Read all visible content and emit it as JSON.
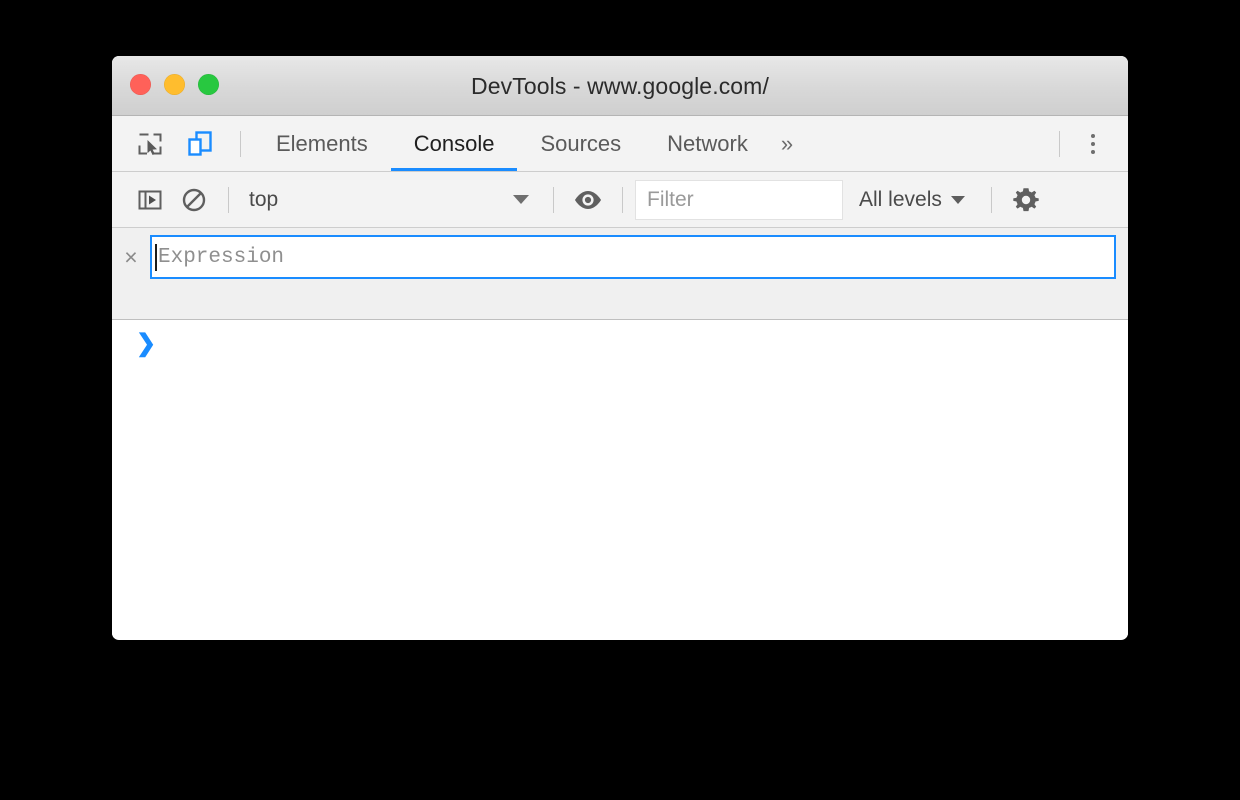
{
  "window": {
    "title": "DevTools - www.google.com/",
    "traffic_lights": [
      {
        "name": "close",
        "color": "#ff6159"
      },
      {
        "name": "minimize",
        "color": "#ffbd2e"
      },
      {
        "name": "maximize",
        "color": "#28c840"
      }
    ]
  },
  "toolbar_left": {
    "inspect_icon": "inspect-element-icon",
    "device_icon": "device-toolbar-icon",
    "device_icon_active_color": "#1a8cff"
  },
  "tabs": [
    {
      "label": "Elements",
      "active": false
    },
    {
      "label": "Console",
      "active": true
    },
    {
      "label": "Sources",
      "active": false
    },
    {
      "label": "Network",
      "active": false
    }
  ],
  "tab_overflow": "»",
  "tab_accent_color": "#1a8cff",
  "main_menu_icon": "kebab-menu-icon",
  "console_toolbar": {
    "sidebar_icon": "show-console-sidebar-icon",
    "clear_icon": "clear-console-icon",
    "context": "top",
    "eye_icon": "create-live-expression-icon",
    "filter_placeholder": "Filter",
    "filter_value": "",
    "levels": "All levels",
    "settings_icon": "gear-icon"
  },
  "live_expression": {
    "remove_label": "×",
    "placeholder": "Expression",
    "value": "",
    "focused": true,
    "focus_color": "#1a8cff"
  },
  "console": {
    "prompt": "❯",
    "prompt_color": "#1a8cff",
    "messages": []
  }
}
